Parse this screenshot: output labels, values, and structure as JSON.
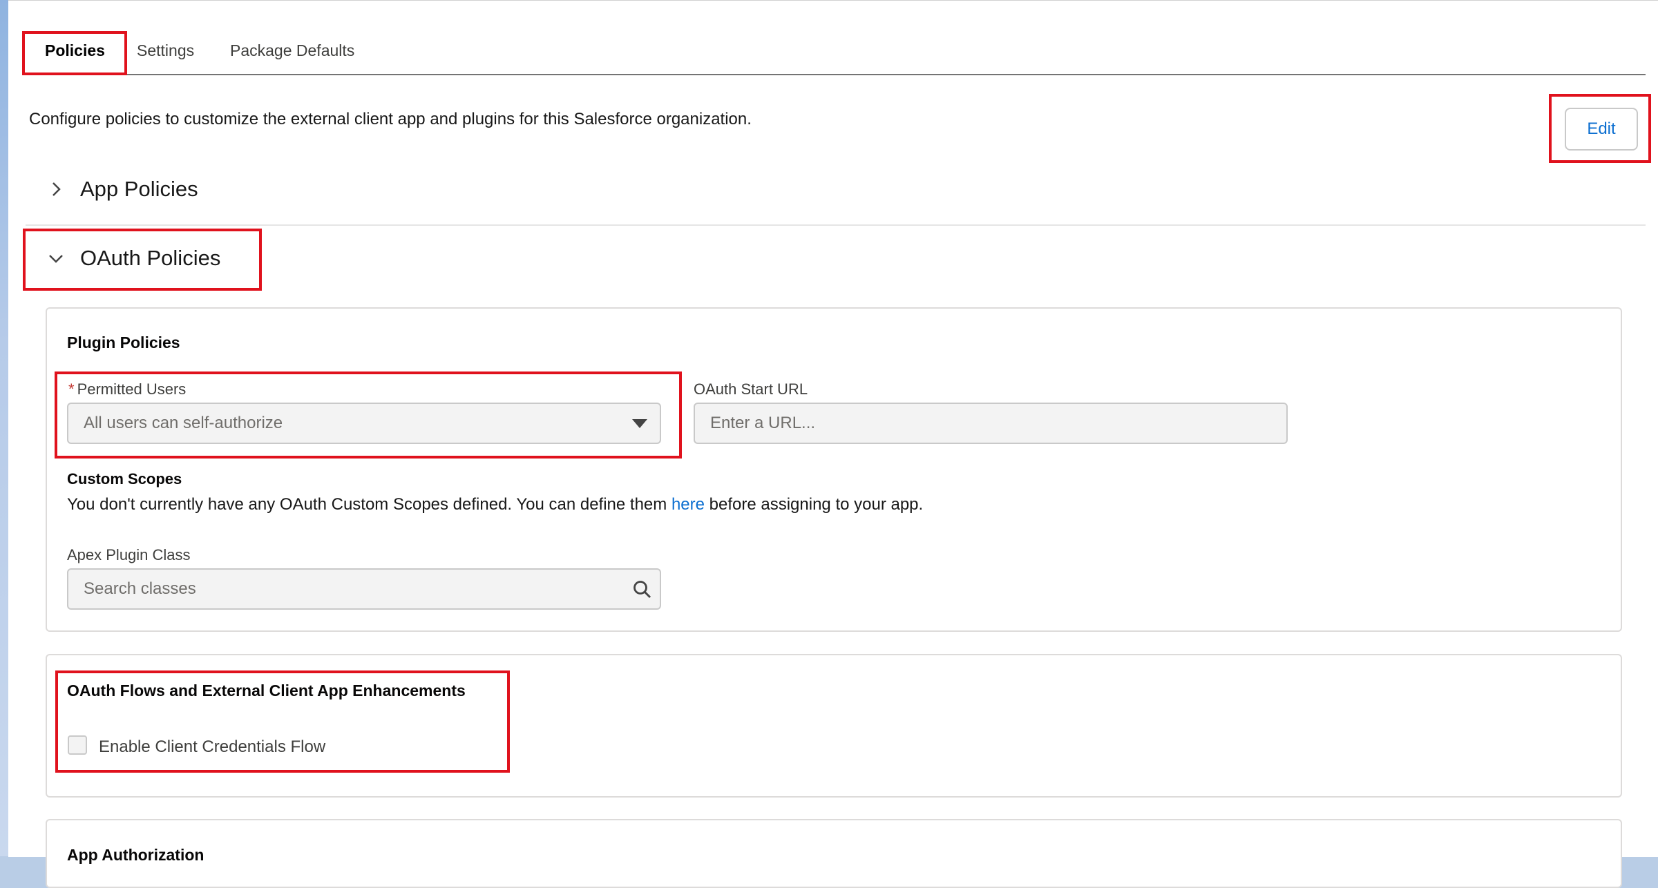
{
  "tabs": [
    {
      "label": "Policies",
      "active": true
    },
    {
      "label": "Settings",
      "active": false
    },
    {
      "label": "Package Defaults",
      "active": false
    }
  ],
  "intro_text": "Configure policies to customize the external client app and plugins for this Salesforce organization.",
  "edit_label": "Edit",
  "sections": {
    "app_policies": {
      "title": "App Policies",
      "expanded": false
    },
    "oauth_policies": {
      "title": "OAuth Policies",
      "expanded": true
    }
  },
  "plugin_policies": {
    "heading": "Plugin Policies",
    "permitted_users": {
      "required_marker": "*",
      "label": "Permitted Users",
      "value": "All users can self-authorize"
    },
    "oauth_start_url": {
      "label": "OAuth Start URL",
      "placeholder": "Enter a URL..."
    },
    "custom_scopes": {
      "heading": "Custom Scopes",
      "text_before": "You don't currently have any OAuth Custom Scopes defined. You can define them ",
      "link": "here",
      "text_after": " before assigning to your app."
    },
    "apex_plugin_class": {
      "label": "Apex Plugin Class",
      "placeholder": "Search classes"
    }
  },
  "oauth_flows": {
    "heading": "OAuth Flows and External Client App Enhancements",
    "client_credentials": {
      "label": "Enable Client Credentials Flow",
      "checked": false
    }
  },
  "app_authorization": {
    "heading": "App Authorization"
  },
  "colors": {
    "highlight": "#e0121d",
    "link": "#0b6ed0",
    "required": "#c23934"
  },
  "icons": [
    "chevron-right-icon",
    "chevron-down-icon",
    "dropdown-caret-icon",
    "search-icon"
  ]
}
